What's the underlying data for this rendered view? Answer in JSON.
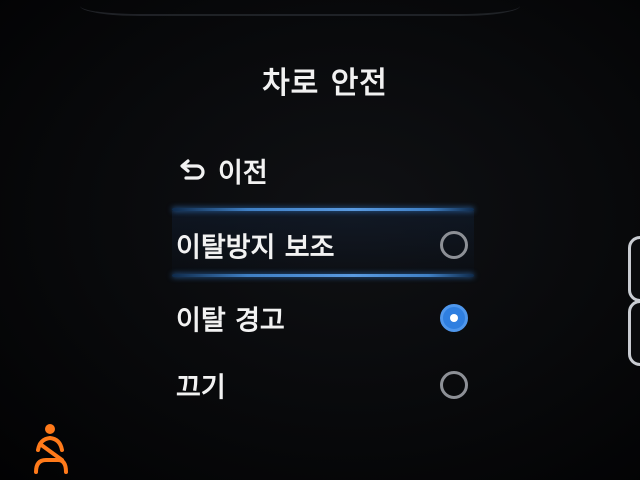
{
  "menu": {
    "title": "차로 안전",
    "back": {
      "icon": "back-arrow-icon",
      "label": "이전"
    },
    "options": [
      {
        "label": "이탈방지 보조",
        "selected": false,
        "highlighted": true
      },
      {
        "label": "이탈 경고",
        "selected": true,
        "highlighted": false
      },
      {
        "label": "끄기",
        "selected": false,
        "highlighted": false
      }
    ]
  },
  "indicators": {
    "seatbelt_warning": {
      "icon": "seatbelt-warning-icon",
      "color": "#ff7a1a"
    }
  },
  "colors": {
    "background": "#050506",
    "text": "#f2f2f2",
    "accent": "#2f7fe0",
    "radio_outline": "#8d9096"
  }
}
